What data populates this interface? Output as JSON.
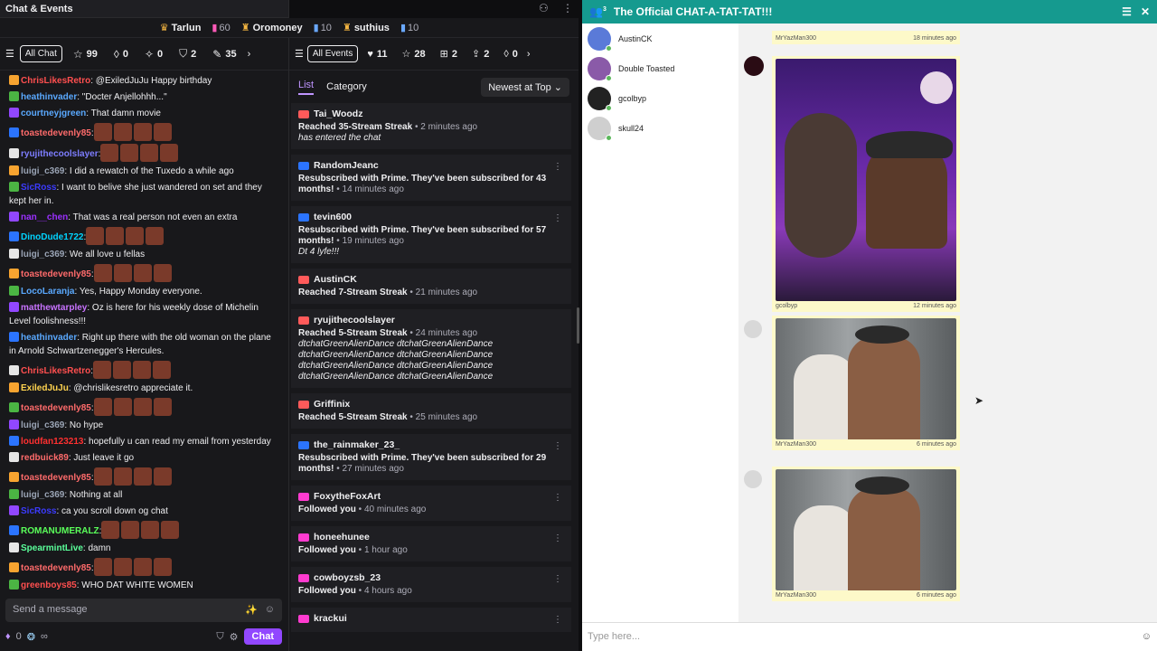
{
  "chat": {
    "title": "Chat & Events",
    "input_placeholder": "Send a message",
    "chat_btn": "Chat",
    "bottom_count": "0",
    "infinity": "∞",
    "top_users": [
      {
        "name": "Tarlun",
        "count": "60"
      },
      {
        "name": "Oromoney",
        "count": "10"
      },
      {
        "name": "suthius",
        "count": "10"
      }
    ],
    "tab_all": "All Chat",
    "stats": [
      "99",
      "0",
      "0",
      "2",
      "35"
    ],
    "messages": [
      {
        "user": "ChrisLikesRetro",
        "color": "#ff4f4f",
        "text": ": @ExiledJuJu Happy birthday"
      },
      {
        "user": "heathinvader",
        "color": "#5aa9ff",
        "text": ": \"Docter Anjellohhh...\""
      },
      {
        "user": "courtneyjgreen",
        "color": "#5aa9ff",
        "text": ": That damn movie"
      },
      {
        "user": "toastedevenly85",
        "color": "#ff6b6b",
        "text": ":"
      },
      {
        "user": "ryujithecoolslayer",
        "color": "#7d7dff",
        "text": ":"
      },
      {
        "user": "luigi_c369",
        "color": "#9aa4b5",
        "text": ": I did a rewatch of the Tuxedo a while ago"
      },
      {
        "user": "SicRoss",
        "color": "#3b3bff",
        "text": ": I want to belive she just wandered on set and they kept her in."
      },
      {
        "user": "nan__chen",
        "color": "#9b30ff",
        "text": ": That was a real person not even an extra"
      },
      {
        "user": "DinoDude1722",
        "color": "#00d4ff",
        "text": ":"
      },
      {
        "user": "luigi_c369",
        "color": "#9aa4b5",
        "text": ": We all love u fellas"
      },
      {
        "user": "toastedevenly85",
        "color": "#ff6b6b",
        "text": ":"
      },
      {
        "user": "LocoLaranja",
        "color": "#5aa9ff",
        "text": ": Yes, Happy Monday everyone."
      },
      {
        "user": "matthewtarpley",
        "color": "#c873ff",
        "text": ": Oz is here for his weekly dose of Michelin Level foolishness!!!"
      },
      {
        "user": "heathinvader",
        "color": "#5aa9ff",
        "text": ": Right up there with the old woman on the plane in Arnold Schwartzenegger's Hercules."
      },
      {
        "user": "ChrisLikesRetro",
        "color": "#ff4f4f",
        "text": ":"
      },
      {
        "user": "ExiledJuJu",
        "color": "#ffd34f",
        "text": ": @chrislikesretro appreciate it."
      },
      {
        "user": "toastedevenly85",
        "color": "#ff6b6b",
        "text": ":"
      },
      {
        "user": "luigi_c369",
        "color": "#9aa4b5",
        "text": ": No hype"
      },
      {
        "user": "loudfan123213",
        "color": "#ff3030",
        "text": ": hopefully u can read my email from yesterday"
      },
      {
        "user": "redbuick89",
        "color": "#ff6b6b",
        "text": ": Just leave it go"
      },
      {
        "user": "toastedevenly85",
        "color": "#ff6b6b",
        "text": ":"
      },
      {
        "user": "luigi_c369",
        "color": "#9aa4b5",
        "text": ": Nothing at all"
      },
      {
        "user": "SicRoss",
        "color": "#3b3bff",
        "text": ": ca you scroll down og chat"
      },
      {
        "user": "ROMANUMERALZ",
        "color": "#5aff5a",
        "text": ":"
      },
      {
        "user": "SpearmintLive",
        "color": "#5aff9a",
        "text": ": damn"
      },
      {
        "user": "toastedevenly85",
        "color": "#ff6b6b",
        "text": ":"
      },
      {
        "user": "greenboys85",
        "color": "#ff4f4f",
        "text": ": WHO DAT WHITE WOMEN"
      }
    ]
  },
  "events": {
    "tab_all": "All Events",
    "stats": [
      "11",
      "28",
      "2",
      "2",
      "0"
    ],
    "list_tab": "List",
    "category_tab": "Category",
    "sort": "Newest at Top",
    "items": [
      {
        "name": "Tai_Woodz",
        "line": "Reached 35-Stream Streak",
        "time": " • 2 minutes ago",
        "note": "has entered the chat",
        "kind": "streak"
      },
      {
        "name": "RandomJeanc",
        "line": "Resubscribed with Prime. They've been subscribed for 43 months!",
        "time": " • 14 minutes ago",
        "note": "",
        "kind": "sub"
      },
      {
        "name": "tevin600",
        "line": "Resubscribed with Prime. They've been subscribed for 57 months!",
        "time": " • 19 minutes ago",
        "note": "Dt 4 lyfe!!!",
        "kind": "sub"
      },
      {
        "name": "AustinCK",
        "line": "Reached 7-Stream Streak",
        "time": " • 21 minutes ago",
        "note": "",
        "kind": "streak"
      },
      {
        "name": "ryujithecoolslayer",
        "line": "Reached 5-Stream Streak",
        "time": " • 24 minutes ago",
        "note": "dtchatGreenAlienDance dtchatGreenAlienDance dtchatGreenAlienDance dtchatGreenAlienDance dtchatGreenAlienDance dtchatGreenAlienDance dtchatGreenAlienDance dtchatGreenAlienDance",
        "kind": "streak"
      },
      {
        "name": "Griffinix",
        "line": "Reached 5-Stream Streak",
        "time": " • 25 minutes ago",
        "note": "",
        "kind": "streak"
      },
      {
        "name": "the_rainmaker_23_",
        "line": "Resubscribed with Prime. They've been subscribed for 29 months!",
        "time": " • 27 minutes ago",
        "note": "",
        "kind": "sub"
      },
      {
        "name": "FoxytheFoxArt",
        "line": "Followed you",
        "time": " • 40 minutes ago",
        "note": "",
        "kind": "follow"
      },
      {
        "name": "honeehunee",
        "line": "Followed you",
        "time": " • 1 hour ago",
        "note": "",
        "kind": "follow"
      },
      {
        "name": "cowboyzsb_23",
        "line": "Followed you",
        "time": " • 4 hours ago",
        "note": "",
        "kind": "follow"
      },
      {
        "name": "krackui",
        "line": "",
        "time": "",
        "note": "",
        "kind": "follow"
      }
    ]
  },
  "app": {
    "title": "The Official CHAT-A-TAT-TAT!!!",
    "badge": "3",
    "input_placeholder": "Type here...",
    "users": [
      "AustinCK",
      "Double Toasted",
      "gcolbyp",
      "skull24"
    ],
    "posts": [
      {
        "author": "MrYazMan300",
        "time": "18 minutes ago"
      },
      {
        "author": "gcolbyp",
        "time": "12 minutes ago"
      },
      {
        "author": "MrYazMan300",
        "time": "6 minutes ago"
      },
      {
        "author": "MrYazMan300",
        "time": "6 minutes ago"
      }
    ]
  },
  "colors": {
    "accent": "#9147ff",
    "app_bar": "#159a8f",
    "post_bg": "#fdf9c9"
  }
}
